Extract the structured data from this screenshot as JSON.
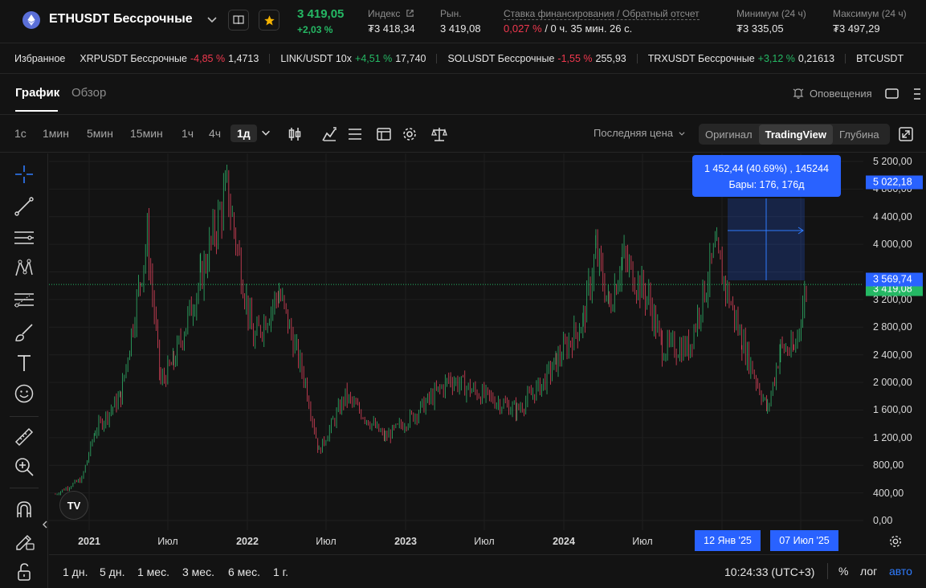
{
  "header": {
    "pair_title": "ETHUSDT Бессрочные",
    "last_price": "3 419,05",
    "change_pct": "+2,03 %",
    "stats": [
      {
        "label": "Индекс",
        "value": "₮3 418,34"
      },
      {
        "label": "Рын.",
        "value": "3 419,08"
      },
      {
        "label": "Ставка финансирования / Обратный отсчет",
        "value_red": "0,027 %",
        "value_rest": " / 0 ч. 35 мин. 26 с."
      },
      {
        "label": "Минимум (24 ч)",
        "value": "₮3 335,05"
      },
      {
        "label": "Максимум (24 ч)",
        "value": "₮3 497,29"
      }
    ]
  },
  "ticker": {
    "fav_label": "Избранное",
    "items": [
      {
        "name": "XRPUSDT Бессрочные",
        "change": "-4,85 %",
        "price": "1,4713",
        "dir": "down"
      },
      {
        "name": "LINK/USDT 10x",
        "change": "+4,51 %",
        "price": "17,740",
        "dir": "up"
      },
      {
        "name": "SOLUSDT Бессрочные",
        "change": "-1,55 %",
        "price": "255,93",
        "dir": "down"
      },
      {
        "name": "TRXUSDT Бессрочные",
        "change": "+3,12 %",
        "price": "0,21613",
        "dir": "up"
      },
      {
        "name": "BTCUSDT",
        "change": "",
        "price": "",
        "dir": "up"
      }
    ]
  },
  "tabs": {
    "chart": "График",
    "overview": "Обзор",
    "alerts": "Оповещения"
  },
  "toolbar": {
    "timeframes": [
      "1с",
      "1мин",
      "5мин",
      "15мин",
      "1ч",
      "4ч",
      "1д"
    ],
    "active_timeframe": "1д",
    "last_price_select": "Последняя цена",
    "modes": [
      "Оригинал",
      "TradingView",
      "Глубина"
    ],
    "active_mode": "TradingView"
  },
  "chart": {
    "price_ticks": [
      "5 200,00",
      "4 800,00",
      "4 400,00",
      "4 000,00",
      "3 200,00",
      "2 800,00",
      "2 400,00",
      "2 000,00",
      "1 600,00",
      "1 200,00",
      "800,00",
      "400,00",
      "0,00"
    ],
    "tag_top": "5 022,18",
    "tag_mid": "3 569,74",
    "tag_last": "3 419,08",
    "measure_line1": "1 452,44 (40.69%) , 145244",
    "measure_line2": "Бары: 176, 176д",
    "time_ticks": [
      {
        "label": "2021",
        "bold": true
      },
      {
        "label": "Июл",
        "bold": false
      },
      {
        "label": "2022",
        "bold": true
      },
      {
        "label": "Июл",
        "bold": false
      },
      {
        "label": "2023",
        "bold": true
      },
      {
        "label": "Июл",
        "bold": false
      },
      {
        "label": "2024",
        "bold": true
      },
      {
        "label": "Июл",
        "bold": false
      }
    ],
    "time_tag_start": "12 Янв '25",
    "time_tag_end": "07 Июл '25",
    "logo_text": "TV",
    "colors": {
      "up": "#26a69a",
      "down": "#ef5350",
      "measure": "#2962ff",
      "last": "#25b864"
    }
  },
  "chart_data": {
    "type": "candlestick",
    "symbol": "ETHUSDT",
    "interval": "1д",
    "x_range": [
      "2020-10",
      "2025-07"
    ],
    "ylim": [
      0,
      5200
    ],
    "approx_closes": [
      {
        "t": "2020-10",
        "v": 380
      },
      {
        "t": "2020-12",
        "v": 600
      },
      {
        "t": "2021-01",
        "v": 1300
      },
      {
        "t": "2021-03",
        "v": 1800
      },
      {
        "t": "2021-05",
        "v": 4100
      },
      {
        "t": "2021-06",
        "v": 2000
      },
      {
        "t": "2021-07",
        "v": 2300
      },
      {
        "t": "2021-09",
        "v": 3500
      },
      {
        "t": "2021-11",
        "v": 4800
      },
      {
        "t": "2022-01",
        "v": 2600
      },
      {
        "t": "2022-03",
        "v": 3300
      },
      {
        "t": "2022-05",
        "v": 2000
      },
      {
        "t": "2022-06",
        "v": 1000
      },
      {
        "t": "2022-08",
        "v": 1800
      },
      {
        "t": "2022-11",
        "v": 1200
      },
      {
        "t": "2023-01",
        "v": 1500
      },
      {
        "t": "2023-04",
        "v": 2050
      },
      {
        "t": "2023-06",
        "v": 1850
      },
      {
        "t": "2023-09",
        "v": 1600
      },
      {
        "t": "2023-11",
        "v": 2000
      },
      {
        "t": "2023-12",
        "v": 2300
      },
      {
        "t": "2024-02",
        "v": 2900
      },
      {
        "t": "2024-03",
        "v": 3900
      },
      {
        "t": "2024-04",
        "v": 3100
      },
      {
        "t": "2024-05",
        "v": 3800
      },
      {
        "t": "2024-07",
        "v": 3200
      },
      {
        "t": "2024-08",
        "v": 2500
      },
      {
        "t": "2024-10",
        "v": 2500
      },
      {
        "t": "2024-12",
        "v": 3900
      },
      {
        "t": "2025-02",
        "v": 2600
      },
      {
        "t": "2025-04",
        "v": 1600
      },
      {
        "t": "2025-05",
        "v": 2500
      },
      {
        "t": "2025-06",
        "v": 2450
      },
      {
        "t": "2025-07",
        "v": 3419
      }
    ]
  }
}
